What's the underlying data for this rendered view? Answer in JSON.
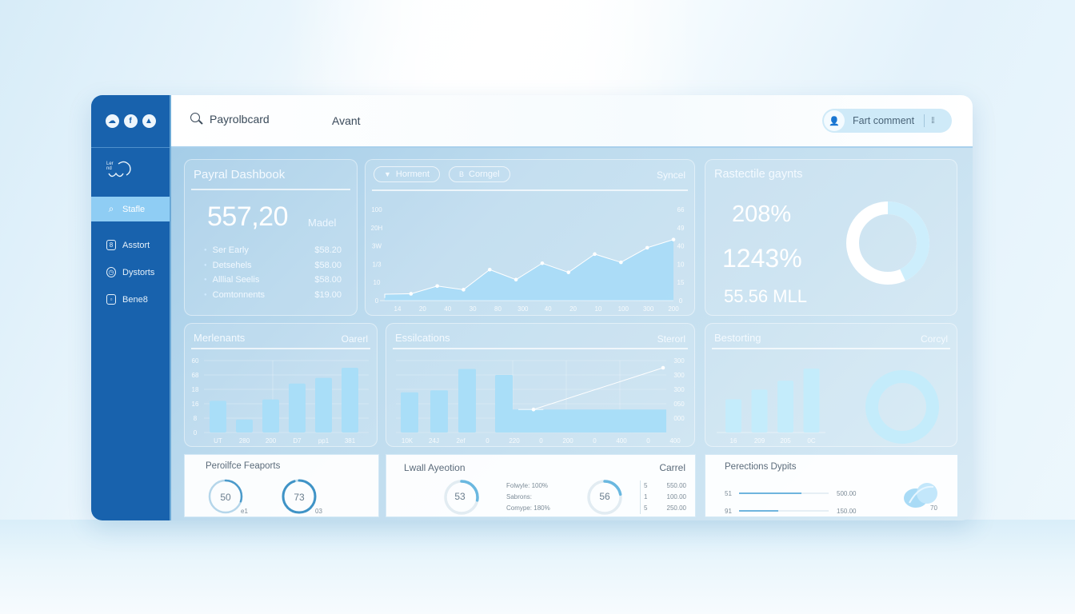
{
  "header": {
    "search_label": "Payrolbcard",
    "nav_link": "Avant",
    "comment_button": "Fart comment",
    "brand_icons": [
      "cloud-icon",
      "facebook-icon",
      "rocket-icon"
    ]
  },
  "sidebar": {
    "items": [
      {
        "label": "Stafle",
        "icon": "search-icon",
        "active": true
      },
      {
        "label": "Asstort",
        "icon": "lock-icon",
        "active": false
      },
      {
        "label": "Dystorts",
        "icon": "clock-icon",
        "active": false
      },
      {
        "label": "Bene8",
        "icon": "calendar-icon",
        "active": false
      }
    ]
  },
  "summary_card": {
    "title": "Payral Dashbook",
    "big_value": "557,20",
    "big_unit": "Madel",
    "rows": [
      {
        "label": "Ser Early",
        "value": "$58.20"
      },
      {
        "label": "Detsehels",
        "value": "$58.00"
      },
      {
        "label": "Alllial Seelis",
        "value": "$58.00"
      },
      {
        "label": "Comtonnents",
        "value": "$19.00"
      }
    ]
  },
  "trend_card": {
    "chips": [
      "Horment",
      "Corngel"
    ],
    "action": "Syncel"
  },
  "stats_card": {
    "title": "Rastectile gaynts",
    "values": [
      "208%",
      "1243%",
      "55.56 MLL"
    ],
    "donut_fraction": 0.43
  },
  "bar_card": {
    "title": "Merlenants",
    "action": "Oarerl"
  },
  "combo_card": {
    "title": "Essilcations",
    "action": "Sterorl"
  },
  "mini_bar_card": {
    "title": "Bestorting",
    "action": "Corcyl"
  },
  "reports_card": {
    "title": "Peroilfce Feaports",
    "gauges": [
      {
        "value": "50",
        "sub": "e1",
        "fraction": 0.3
      },
      {
        "value": "73",
        "sub": "03",
        "fraction": 0.95
      }
    ]
  },
  "projection_card": {
    "title": "Lwall Ayeotion",
    "action": "Carrel",
    "gauge_a": {
      "value": "53",
      "fraction": 0.28
    },
    "gauge_b": {
      "value": "56",
      "fraction": 0.22
    },
    "legend": [
      {
        "label": "Folwyle:",
        "value": "100%"
      },
      {
        "label": "Sabrons:",
        "value": ""
      },
      {
        "label": "Comype:",
        "value": "180%"
      }
    ],
    "table": [
      {
        "k": "5",
        "v": "550.00"
      },
      {
        "k": "1",
        "v": "100.00"
      },
      {
        "k": "5",
        "v": "250.00"
      }
    ]
  },
  "options_card": {
    "title": "Perections Dypits",
    "bars": [
      {
        "label": "51",
        "value": "500.00",
        "fraction": 0.7
      },
      {
        "label": "91",
        "value": "150.00",
        "fraction": 0.44
      }
    ],
    "badge_value": "70"
  },
  "chart_data": [
    {
      "type": "area",
      "title": "",
      "x": [
        "14",
        "20",
        "40",
        "30",
        "80",
        "300",
        "40",
        "20",
        "10",
        "100",
        "300",
        "200"
      ],
      "series": [
        {
          "name": "trend",
          "values": [
            7,
            7.5,
            16,
            12,
            34,
            23,
            41,
            31,
            51,
            42,
            58,
            67
          ]
        }
      ],
      "y_left_ticks": [
        "0",
        "10",
        "1/3",
        "3W",
        "20H",
        "100"
      ],
      "y_right_ticks": [
        "0",
        "15",
        "10",
        "40",
        "49",
        "66"
      ],
      "ylim": [
        0,
        100
      ],
      "grid": false
    },
    {
      "type": "bar",
      "title": "Merlenants",
      "categories": [
        "UT",
        "280",
        "200",
        "D7",
        "pp1",
        "381"
      ],
      "values": [
        44,
        18,
        46,
        68,
        76,
        90
      ],
      "y_ticks": [
        "0",
        "8",
        "16",
        "18",
        "68",
        "60"
      ],
      "ylim": [
        0,
        100
      ],
      "grid": true
    },
    {
      "type": "bar",
      "title": "Essilcations",
      "categories": [
        "10K",
        "24J",
        "2ef",
        "0",
        "220",
        "0",
        "200",
        "0",
        "400",
        "0",
        "400"
      ],
      "bars": [
        60,
        63,
        95,
        86
      ],
      "flat_fill": 32,
      "line": [
        {
          "x": 0.22,
          "y": 32
        },
        {
          "x": 1.0,
          "y": 90
        }
      ],
      "y_right_ticks": [
        "",
        "000",
        "050",
        "300",
        "300",
        "300"
      ],
      "ylim": [
        0,
        100
      ],
      "grid": true
    },
    {
      "type": "bar",
      "title": "Bestorting",
      "categories": [
        "16",
        "209",
        "205",
        "0C"
      ],
      "values": [
        52,
        67,
        81,
        100
      ],
      "ylim": [
        0,
        100
      ],
      "grid": false
    }
  ]
}
